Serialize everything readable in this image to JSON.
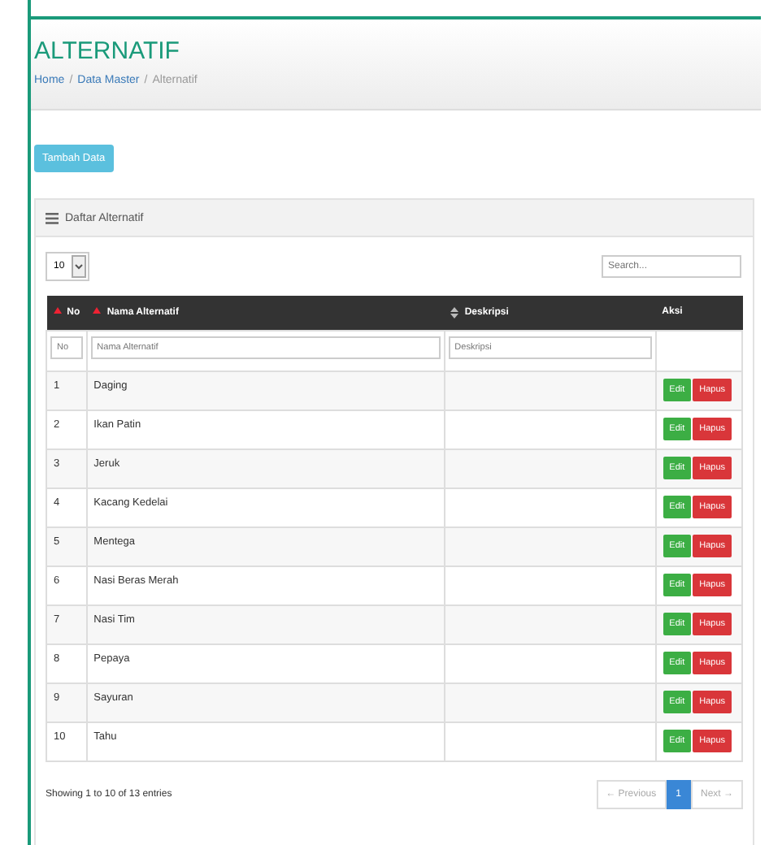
{
  "page_header": {
    "title": "ALTERNATIF",
    "breadcrumb": [
      {
        "label": "Home",
        "kind": "link"
      },
      {
        "separator": "/",
        "label": "Data Master",
        "kind": "link"
      },
      {
        "separator": "/",
        "label": "Alternatif",
        "kind": "current"
      }
    ]
  },
  "add_button": "Tambah Data",
  "panel": {
    "title": "Daftar Alternatif",
    "page_length": "10",
    "search": {
      "placeholder": "Search..."
    },
    "columns": [
      {
        "label": "No",
        "sorted": true
      },
      {
        "label": "Nama Alternatif",
        "sorted": true
      },
      {
        "label": "Deskripsi",
        "sorted": false
      },
      {
        "label": "Aksi"
      }
    ],
    "filters": [
      {
        "placeholder": "No"
      },
      {
        "placeholder": "Nama Alternatif"
      },
      {
        "placeholder": "Deskripsi"
      }
    ],
    "rows": [
      {
        "no": "1",
        "name": "Daging",
        "actions": [
          {
            "label": "Edit",
            "kind": "edit"
          },
          {
            "label": "Hapus",
            "kind": "delete"
          }
        ]
      },
      {
        "no": "2",
        "name": "Ikan Patin",
        "actions": [
          {
            "label": "Edit",
            "kind": "edit"
          },
          {
            "label": "Hapus",
            "kind": "delete"
          }
        ]
      },
      {
        "no": "3",
        "name": "Jeruk",
        "actions": [
          {
            "label": "Edit",
            "kind": "edit"
          },
          {
            "label": "Hapus",
            "kind": "delete"
          }
        ]
      },
      {
        "no": "4",
        "name": "Kacang Kedelai",
        "actions": [
          {
            "label": "Edit",
            "kind": "edit"
          },
          {
            "label": "Hapus",
            "kind": "delete"
          }
        ]
      },
      {
        "no": "5",
        "name": "Mentega",
        "actions": [
          {
            "label": "Edit",
            "kind": "edit"
          },
          {
            "label": "Hapus",
            "kind": "delete"
          }
        ]
      },
      {
        "no": "6",
        "name": "Nasi Beras Merah",
        "actions": [
          {
            "label": "Edit",
            "kind": "edit"
          },
          {
            "label": "Hapus",
            "kind": "delete"
          }
        ]
      },
      {
        "no": "7",
        "name": "Nasi Tim",
        "actions": [
          {
            "label": "Edit",
            "kind": "edit"
          },
          {
            "label": "Hapus",
            "kind": "delete"
          }
        ]
      },
      {
        "no": "8",
        "name": "Pepaya",
        "actions": [
          {
            "label": "Edit",
            "kind": "edit"
          },
          {
            "label": "Hapus",
            "kind": "delete"
          }
        ]
      },
      {
        "no": "9",
        "name": "Sayuran",
        "actions": [
          {
            "label": "Edit",
            "kind": "edit"
          },
          {
            "label": "Hapus",
            "kind": "delete"
          }
        ]
      },
      {
        "no": "10",
        "name": "Tahu",
        "actions": [
          {
            "label": "Edit",
            "kind": "edit"
          },
          {
            "label": "Hapus",
            "kind": "delete"
          }
        ]
      }
    ],
    "info": "Showing 1 to 10 of 13 entries",
    "pagination": [
      {
        "label": "← Previous",
        "selected": false,
        "disabled": true
      },
      {
        "label": "1",
        "selected": true,
        "disabled": false
      },
      {
        "label": "Next →",
        "selected": false,
        "disabled": true
      }
    ]
  }
}
